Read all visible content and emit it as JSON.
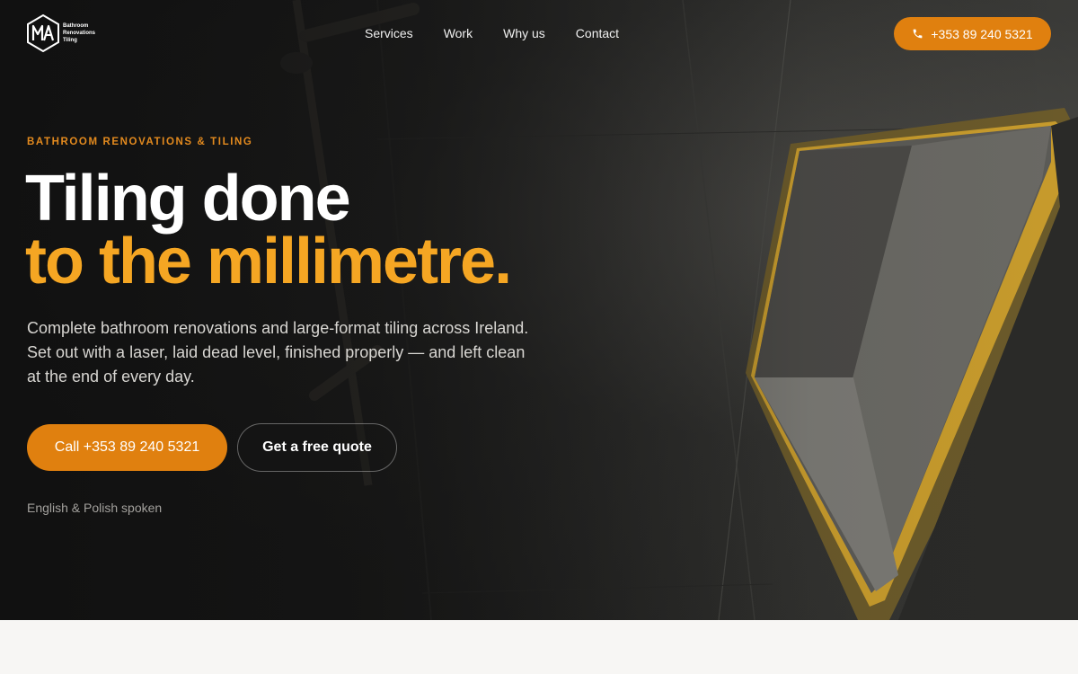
{
  "brand": {
    "logo_initials": "MA",
    "logo_lines": [
      "Bathroom",
      "Renovations",
      "Tiling"
    ],
    "accent_color": "#e0800f",
    "highlight_color": "#f5a623"
  },
  "nav": {
    "links": [
      "Services",
      "Work",
      "Why us",
      "Contact"
    ],
    "phone_label": "+353 89 240 5321",
    "phone_icon": "phone-icon"
  },
  "hero": {
    "eyebrow": "BATHROOM RENOVATIONS & TILING",
    "headline_line1": "Tiling done",
    "headline_line2": "to the millimetre.",
    "lede": "Complete bathroom renovations and large-format tiling across Ireland. Set out with a laser, laid dead level, finished properly — and left clean at the end of every day.",
    "cta_primary": "Call +353 89 240 5321",
    "cta_secondary": "Get a free quote",
    "languages_note": "English & Polish spoken"
  }
}
